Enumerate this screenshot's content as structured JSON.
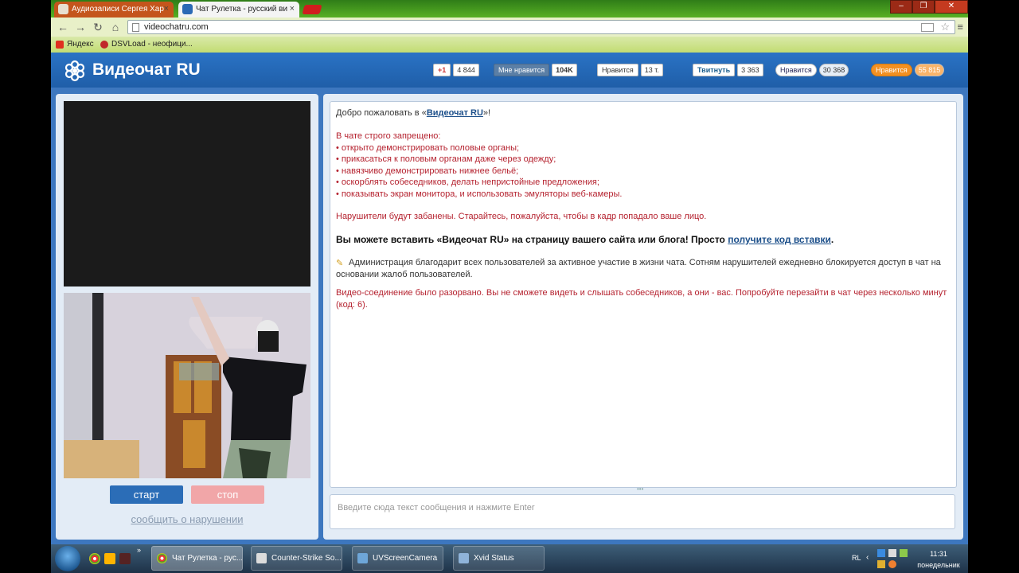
{
  "browser": {
    "tabs": [
      {
        "title": "Аудиозаписи Сергея Хар",
        "close": "×"
      },
      {
        "title": "Чат Рулетка - русский ви",
        "close": "×"
      }
    ],
    "url": "videochatru.com",
    "bookmarks": [
      "Яндекс",
      "DSVLoad - неофици..."
    ],
    "window_controls": [
      "–",
      "❐",
      "✕"
    ]
  },
  "site": {
    "logo_text": "Видеочат RU",
    "social": {
      "gplus_label": "+1",
      "gplus_count": "4 844",
      "vk_label": "Мне нравится",
      "vk_count": "104K",
      "fb_label": "Нравится",
      "fb_count": "13 т.",
      "tw_label": "Твитнуть",
      "tw_count": "3 363",
      "mm_label": "Нравится",
      "mm_count": "30 368",
      "ok_label": "Нравится",
      "ok_count": "55 815"
    }
  },
  "video": {
    "start_label": "старт",
    "stop_label": "стоп",
    "report_label": "сообщить о нарушении"
  },
  "chat": {
    "welcome_prefix": "Добро пожаловать в «",
    "welcome_link": "Видеочат RU",
    "welcome_suffix": "»!",
    "rules_title": "В чате строго запрещено:",
    "rules": [
      "• открыто демонстрировать половые органы;",
      "• прикасаться к половым органам даже через одежду;",
      "• навязчиво демонстрировать нижнее бельё;",
      "• оскорблять собеседников, делать непристойные предложения;",
      "• показывать экран монитора, и использовать эмуляторы веб-камеры."
    ],
    "ban_notice": "Нарушители будут забанены. Старайтесь, пожалуйста, чтобы в кадр попадало ваше лицо.",
    "embed_text": "Вы можете вставить «Видеочат RU» на страницу вашего сайта или блога! Просто",
    "embed_link": "получите код вставки",
    "embed_end": ".",
    "admin_notice": "Администрация благодарит всех пользователей за активное участие в жизни чата. Сотням нарушителей ежедневно блокируется доступ в чат на основании жалоб пользователей.",
    "disconnect_notice": "Видео-соединение было разорвано. Вы не сможете видеть и слышать собеседников, а они - вас. Попробуйте перезайти в чат через несколько минут (код: 6).",
    "input_placeholder": "Введите сюда текст сообщения и нажмите Enter"
  },
  "taskbar": {
    "tasks": [
      "Чат Рулетка - рус...",
      "Counter-Strike So...",
      "UVScreenCamera",
      "Xvid Status"
    ],
    "lang": "RL",
    "time": "11:31",
    "day": "понедельник"
  }
}
